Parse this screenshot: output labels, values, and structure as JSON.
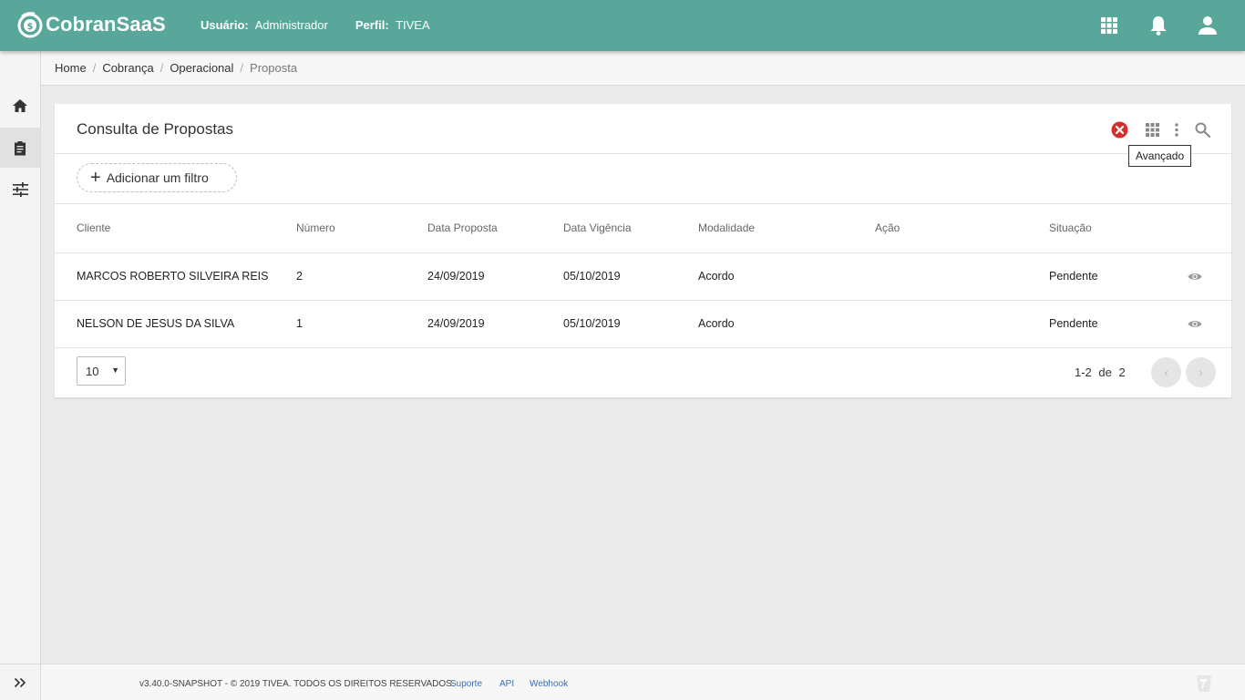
{
  "app": {
    "brand": "CobranSaaS",
    "user_label": "Usuário:",
    "user_value": "Administrador",
    "profile_label": "Perfil:",
    "profile_value": "TIVEA",
    "top_icons": [
      "apps-grid-icon",
      "bell-icon",
      "account-icon"
    ]
  },
  "sidebar": {
    "items": [
      {
        "icon": "home-icon",
        "active": false
      },
      {
        "icon": "clipboard-icon",
        "active": true
      },
      {
        "icon": "sliders-icon",
        "active": false
      }
    ],
    "expand_icon": "double-chevron-right-icon"
  },
  "breadcrumb": [
    "Home",
    "Cobrança",
    "Operacional",
    "Proposta"
  ],
  "card": {
    "title": "Consulta de Propostas",
    "header_icons": [
      "clear-filter-icon",
      "columns-grid-icon",
      "more-vertical-icon",
      "search-icon"
    ],
    "tooltip": "Avançado",
    "add_filter": "Adicionar um filtro"
  },
  "table": {
    "columns": [
      "Cliente",
      "Número",
      "Data Proposta",
      "Data Vigência",
      "Modalidade",
      "Ação",
      "Situação"
    ],
    "rows": [
      {
        "cliente": "MARCOS ROBERTO SILVEIRA REIS",
        "numero": "2",
        "data_proposta": "24/09/2019",
        "data_vigencia": "05/10/2019",
        "modalidade": "Acordo",
        "acao": "",
        "situacao": "Pendente"
      },
      {
        "cliente": "NELSON DE JESUS DA SILVA",
        "numero": "1",
        "data_proposta": "24/09/2019",
        "data_vigencia": "05/10/2019",
        "modalidade": "Acordo",
        "acao": "",
        "situacao": "Pendente"
      }
    ]
  },
  "pagination": {
    "page_size": "10",
    "range": "1-2",
    "of": "de",
    "total": "2",
    "prev": "‹",
    "next": "›"
  },
  "footer": {
    "copyright": "v3.40.0-SNAPSHOT - © 2019 TIVEA. TODOS OS DIREITOS RESERVADOS.",
    "links": [
      "Suporte",
      "API",
      "Webhook"
    ]
  },
  "colors": {
    "topbar": "#58a79a",
    "clear_icon": "#d32f2f",
    "link": "#3a6fb0"
  }
}
